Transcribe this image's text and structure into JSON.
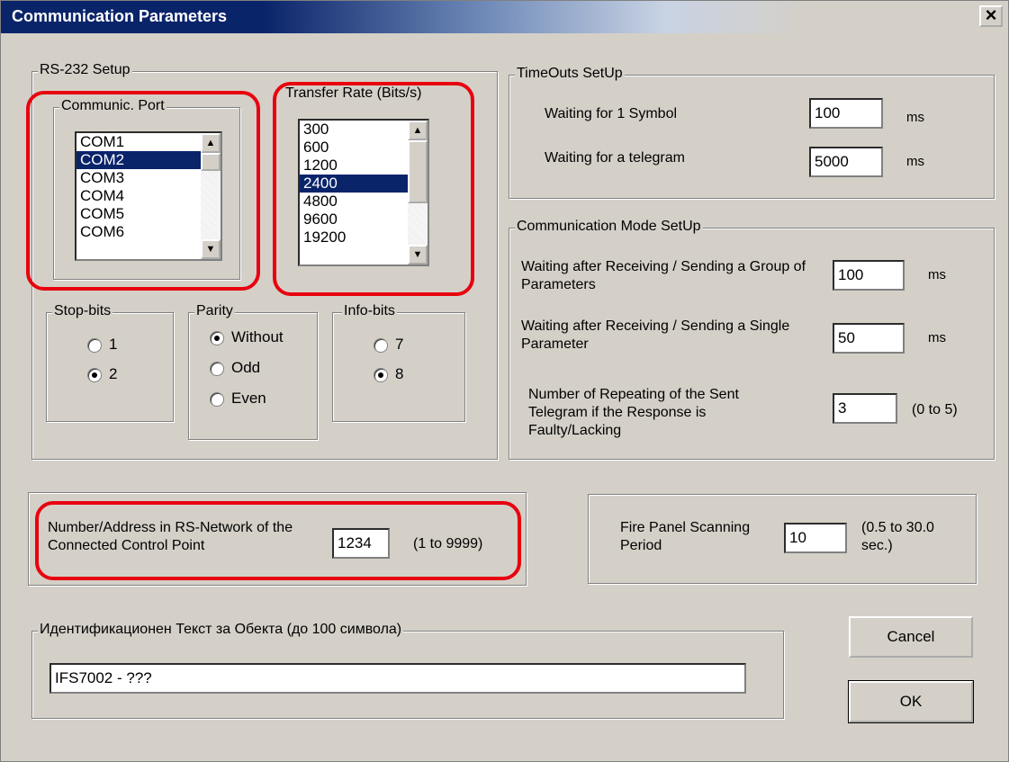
{
  "window": {
    "title": "Communication Parameters",
    "close": "×"
  },
  "rs232": {
    "group_label": "RS-232 Setup",
    "port": {
      "label": "Communic. Port",
      "items": [
        "COM1",
        "COM2",
        "COM3",
        "COM4",
        "COM5",
        "COM6"
      ],
      "selected": "COM2"
    },
    "rate": {
      "label": "Transfer Rate (Bits/s)",
      "items": [
        "300",
        "600",
        "1200",
        "2400",
        "4800",
        "9600",
        "19200"
      ],
      "selected": "2400"
    },
    "stopbits": {
      "label": "Stop-bits",
      "options": [
        "1",
        "2"
      ],
      "selected": "2"
    },
    "parity": {
      "label": "Parity",
      "options": [
        "Without",
        "Odd",
        "Even"
      ],
      "selected": "Without"
    },
    "infobits": {
      "label": "Info-bits",
      "options": [
        "7",
        "8"
      ],
      "selected": "8"
    }
  },
  "timeouts": {
    "group_label": "TimeOuts SetUp",
    "symbol": {
      "label": "Waiting for 1 Symbol",
      "value": "100",
      "unit": "ms"
    },
    "telegram": {
      "label": "Waiting for a telegram",
      "value": "5000",
      "unit": "ms"
    }
  },
  "mode": {
    "group_label": "Communication Mode SetUp",
    "group_params": {
      "label": "Waiting after Receiving / Sending a Group of Parameters",
      "value": "100",
      "unit": "ms"
    },
    "single_param": {
      "label": "Waiting after Receiving / Sending a Single Parameter",
      "value": "50",
      "unit": "ms"
    },
    "repeat": {
      "label": "Number of Repeating of the Sent Telegram if the Response is Faulty/Lacking",
      "value": "3",
      "range": "(0 to 5)"
    }
  },
  "address": {
    "label": "Number/Address in RS-Network of the Connected Control Point",
    "value": "1234",
    "range": "(1 to 9999)"
  },
  "scan": {
    "label": "Fire Panel Scanning Period",
    "value": "10",
    "range": "(0.5 to 30.0 sec.)"
  },
  "ident": {
    "label": "Идентификационен Текст за Обекта  (до 100 символа)",
    "value": "IFS7002 - ???"
  },
  "buttons": {
    "cancel": "Cancel",
    "ok": "OK"
  },
  "colors": {
    "highlight": "#e8000f",
    "selection": "#0a246a",
    "dialog": "#d4d0c8"
  }
}
